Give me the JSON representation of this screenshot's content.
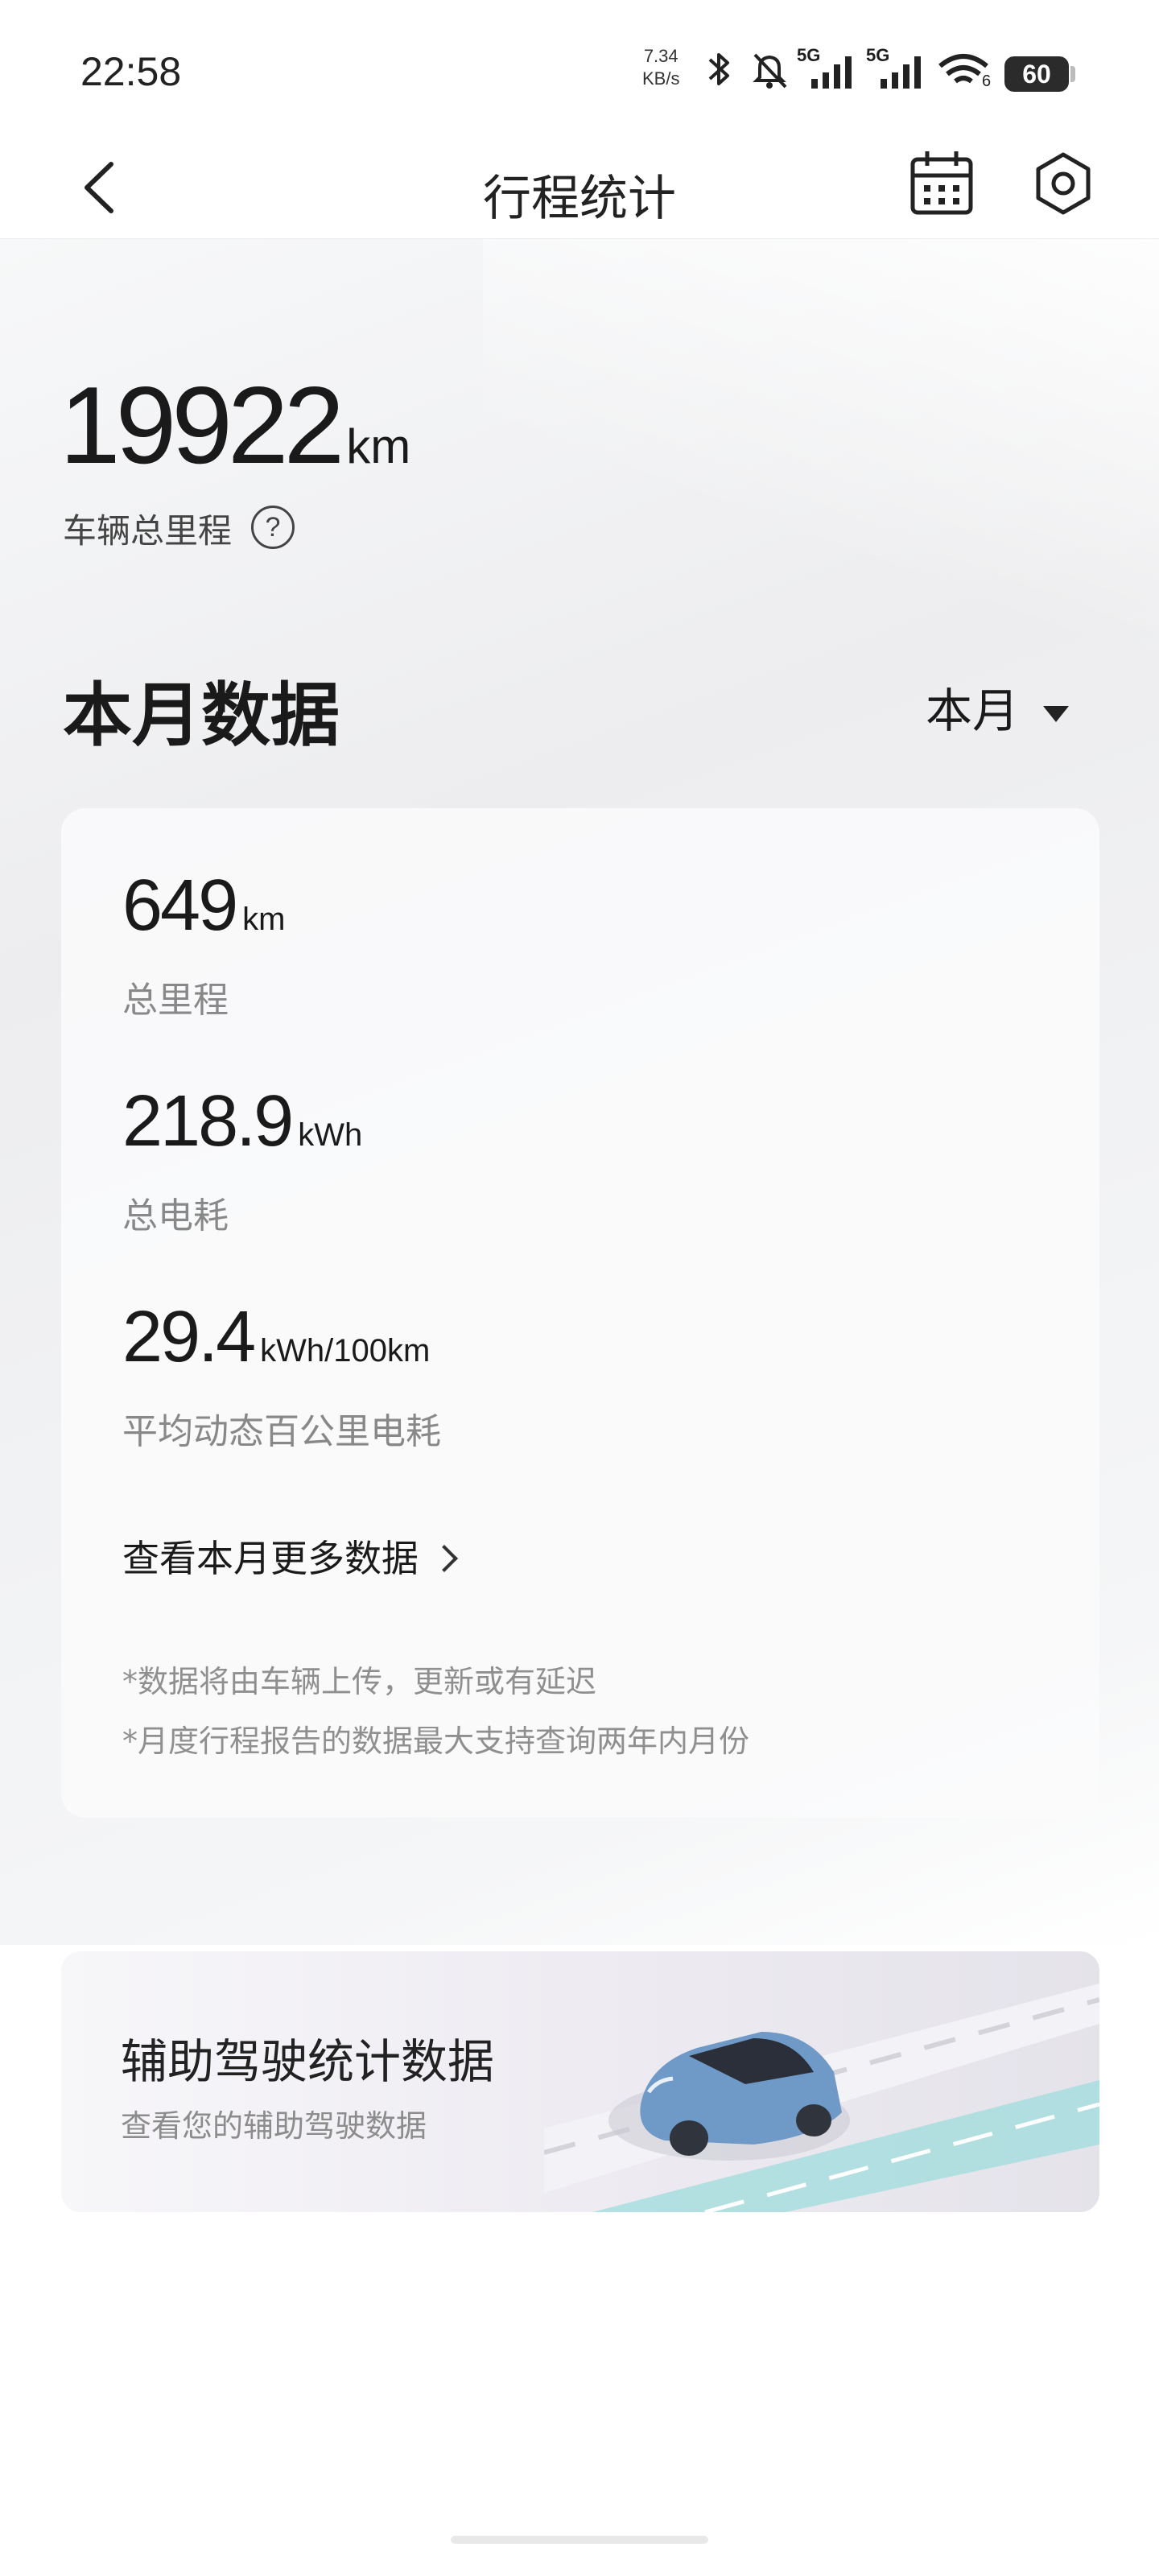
{
  "status_bar": {
    "time": "22:58",
    "net_speed_value": "7.34",
    "net_speed_unit": "KB/s",
    "signal1_label": "5G",
    "signal2_label": "5G",
    "wifi_badge": "6",
    "battery": "60"
  },
  "header": {
    "title": "行程统计"
  },
  "total": {
    "value": "19922",
    "unit": "km",
    "label": "车辆总里程",
    "help": "?"
  },
  "month_section": {
    "title": "本月数据",
    "selector": "本月"
  },
  "metrics": [
    {
      "value": "649",
      "unit": "km",
      "label": "总里程"
    },
    {
      "value": "218.9",
      "unit": "kWh",
      "label": "总电耗"
    },
    {
      "value": "29.4",
      "unit": "kWh/100km",
      "label": "平均动态百公里电耗"
    }
  ],
  "more_link": "查看本月更多数据",
  "notes": [
    "*数据将由车辆上传，更新或有延迟",
    "*月度行程报告的数据最大支持查询两年内月份"
  ],
  "banner": {
    "title": "辅助驾驶统计数据",
    "subtitle": "查看您的辅助驾驶数据"
  },
  "colors": {
    "car_blue": "#6f9ac8",
    "lane_highlight": "#9fdcdc"
  }
}
